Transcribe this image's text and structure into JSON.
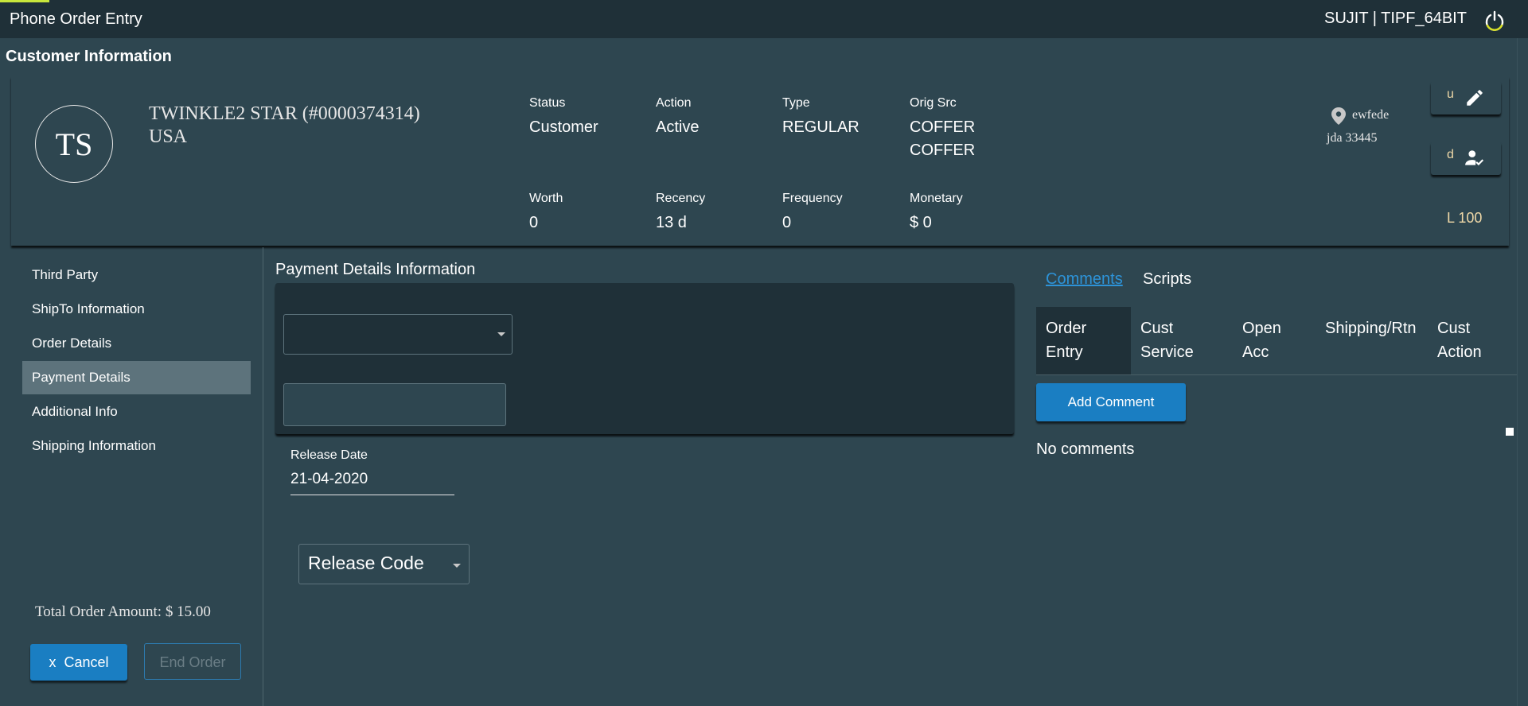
{
  "header": {
    "app_title": "Phone Order Entry",
    "user_info": "SUJIT | TIPF_64BIT",
    "logout_icon": "power-icon",
    "accent_color": "#c8e63c"
  },
  "customer": {
    "section_title": "Customer Information",
    "initials": "TS",
    "name": "TWINKLE2 STAR (#0000374314)",
    "country": "USA",
    "fields": {
      "status": {
        "label": "Status",
        "value": "Customer"
      },
      "action": {
        "label": "Action",
        "value": "Active"
      },
      "type": {
        "label": "Type",
        "value": "REGULAR"
      },
      "orig_src": {
        "label": "Orig Src",
        "value": "COFFER",
        "value2": "COFFER"
      },
      "worth": {
        "label": "Worth",
        "value": "0"
      },
      "recency": {
        "label": "Recency",
        "value": "13 d"
      },
      "frequency": {
        "label": "Frequency",
        "value": "0"
      },
      "monetary": {
        "label": "Monetary",
        "value": "$ 0"
      }
    },
    "address_line1": "ewfede",
    "address_line2": "jda 33445",
    "edit_button_letter": "u",
    "verify_button_letter": "d",
    "loyalty": "L 100"
  },
  "sidebar": {
    "items": [
      {
        "label": "Third Party"
      },
      {
        "label": "ShipTo Information"
      },
      {
        "label": "Order Details"
      },
      {
        "label": "Payment Details"
      },
      {
        "label": "Additional Info"
      },
      {
        "label": "Shipping Information"
      }
    ],
    "active_item": "Payment Details",
    "total_order_amount": "Total Order Amount: $ 15.00",
    "cancel_icon": "x",
    "cancel_label": "Cancel",
    "end_order_label": "End Order"
  },
  "payment": {
    "title": "Payment Details Information",
    "payment_select_value": "",
    "payment_input_value": "",
    "release_date_label": "Release Date",
    "release_date_value": "21-04-2020",
    "release_code_label": "Release Code"
  },
  "comments_panel": {
    "tabs": [
      {
        "label": "Comments",
        "active": true
      },
      {
        "label": "Scripts",
        "active": false
      }
    ],
    "subtabs": [
      {
        "line1": "Order",
        "line2": "Entry"
      },
      {
        "line1": "Cust",
        "line2": "Service"
      },
      {
        "line1": "Open",
        "line2": "Acc"
      },
      {
        "line1": "Shipping/Rtn",
        "line2": ""
      },
      {
        "line1": "Cust",
        "line2": "Action"
      }
    ],
    "add_comment_label": "Add Comment",
    "empty_text": "No comments"
  },
  "colors": {
    "background": "#2e4650",
    "dark_panel": "#1f3038",
    "primary_button": "#1a7ec2",
    "link": "#2d93d8",
    "active_sidebar": "#5d737c",
    "loyalty_text": "#f0d9a8"
  }
}
